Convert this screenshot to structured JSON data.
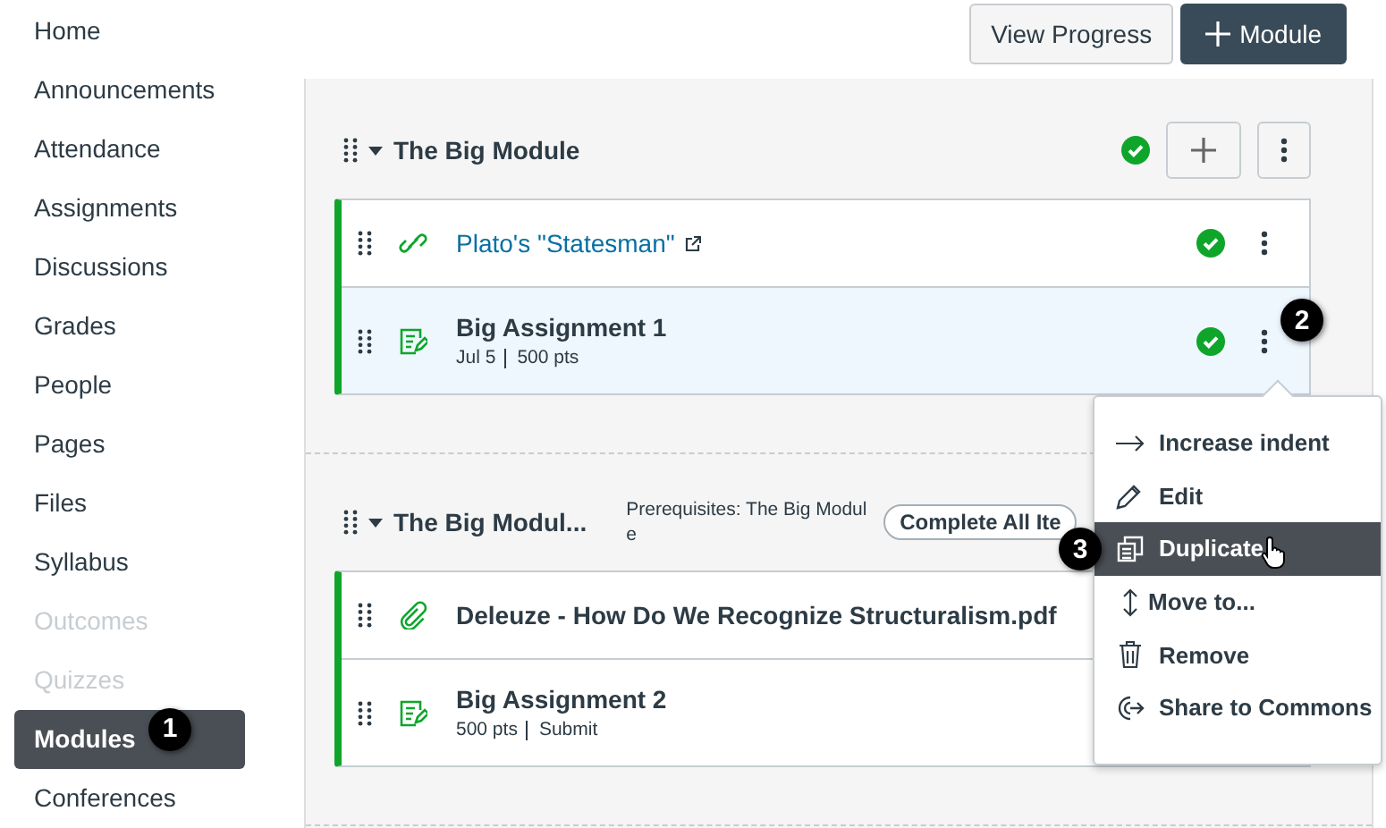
{
  "nav": [
    {
      "label": "Home",
      "disabled": false,
      "selected": false
    },
    {
      "label": "Announcements",
      "disabled": false,
      "selected": false
    },
    {
      "label": "Attendance",
      "disabled": false,
      "selected": false
    },
    {
      "label": "Assignments",
      "disabled": false,
      "selected": false
    },
    {
      "label": "Discussions",
      "disabled": false,
      "selected": false
    },
    {
      "label": "Grades",
      "disabled": false,
      "selected": false
    },
    {
      "label": "People",
      "disabled": false,
      "selected": false
    },
    {
      "label": "Pages",
      "disabled": false,
      "selected": false
    },
    {
      "label": "Files",
      "disabled": false,
      "selected": false
    },
    {
      "label": "Syllabus",
      "disabled": false,
      "selected": false
    },
    {
      "label": "Outcomes",
      "disabled": true,
      "selected": false
    },
    {
      "label": "Quizzes",
      "disabled": true,
      "selected": false
    },
    {
      "label": "Modules",
      "disabled": false,
      "selected": true,
      "callout": "1"
    },
    {
      "label": "Conferences",
      "disabled": false,
      "selected": false
    }
  ],
  "toolbar": [
    {
      "kind": "plain",
      "label": "View Progress"
    },
    {
      "kind": "add",
      "label": "Module"
    }
  ],
  "modules": [
    {
      "title": "The Big Module",
      "published": true,
      "items": [
        {
          "kind": "link",
          "title": "Plato's \"Statesman\"",
          "external": true,
          "published": true,
          "selected": false
        },
        {
          "kind": "assignment",
          "title": "Big Assignment 1",
          "meta": [
            "Jul 5",
            "500 pts"
          ],
          "published": true,
          "selected": true,
          "callout": "2"
        }
      ]
    },
    {
      "title": "The Big Modul...",
      "prerequisites": "Prerequisites: The Big Module",
      "requirement": "Complete All Ite",
      "items": [
        {
          "kind": "file",
          "title": "Deleuze - How Do We Recognize Structuralism.pdf",
          "selected": false
        },
        {
          "kind": "assignment",
          "title": "Big Assignment 2",
          "meta": [
            "500 pts",
            "Submit"
          ],
          "selected": false
        }
      ]
    }
  ],
  "menu": [
    {
      "kind": "indent",
      "label": "Increase indent",
      "selected": false
    },
    {
      "kind": "edit",
      "label": "Edit",
      "selected": false
    },
    {
      "kind": "duplicate",
      "label": "Duplicate",
      "selected": true,
      "callout": "3"
    },
    {
      "kind": "move",
      "label": "Move to...",
      "selected": false
    },
    {
      "kind": "remove",
      "label": "Remove",
      "selected": false
    },
    {
      "kind": "share",
      "label": "Share to Commons",
      "selected": false
    }
  ]
}
